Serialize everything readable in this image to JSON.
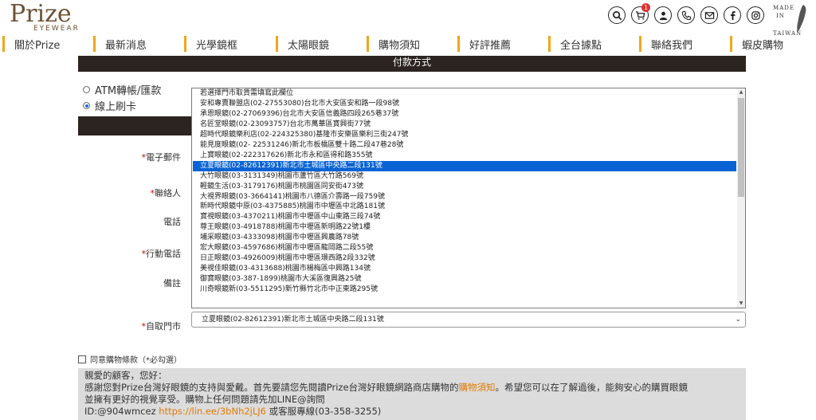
{
  "brand": {
    "name": "Prize",
    "sub": "EYEWEAR"
  },
  "made_in": {
    "line1": "MADE",
    "line2": "IN",
    "line3": "TAIWAN"
  },
  "cart": {
    "count": "1"
  },
  "nav": [
    "關於Prize",
    "最新消息",
    "光學鏡框",
    "太陽眼鏡",
    "購物須知",
    "好評推薦",
    "全台據點",
    "聯絡我們",
    "蝦皮購物"
  ],
  "payment": {
    "section_title": "付款方式",
    "options": [
      "ATM轉帳/匯款",
      "線上刷卡"
    ],
    "selected": 1
  },
  "fields": {
    "email": "電子郵件",
    "contact": "聯絡人",
    "phone": "電話",
    "mobile": "行動電話",
    "note": "備註",
    "pickup": "自取門市",
    "required_mark": "*"
  },
  "store_list": [
    "若選擇門市取貨需填寫此欄位",
    "安和專賣聯盟店(02-27553080)台北市大安區安和路一段98號",
    "承恩眼鏡(02-27069396)台北市大安區信義路四段265巷37號",
    "名匠堂眼鏡(02-23093757)台北市萬華區寶興街77號",
    "超時代眼鏡樂利店(02-224325380)基隆市安樂區樂利三街247號",
    "能見度眼鏡(02- 22531246)新北市板橋區雙十路二段47巷28號",
    "上寶眼鏡(02-222317626)新北市永和區得和路355號",
    "立夏眼鏡(02-82612391)新北市土城區中央路二段131號",
    "大竹眼鏡(03-3131349)桃園市蘆竹區大竹路569號",
    "輕鏡生活(03-3179176)桃園市桃園區同安街473號",
    "大視界眼鏡(03-3664141)桃園市八德區介壽路一段759號",
    "新時代眼鏡中原(03-4375885)桃園市中壢區中北路181號",
    "寶視眼鏡(03-4370211)桃園市中壢區中山東路三段74號",
    "尊王眼鏡(03-4918788)桃園市中壢區新明路22號1樓",
    "埔采眼鏡(03-4333098)桃園市中壢區興農路78號",
    "宏大眼鏡(03-4597686)桃園市中壢區龍岡路二段55號",
    "日正眼鏡(03-4926009)桃園市中壢區環西路2段332號",
    "美視佳眼鏡(03-4313688)桃園市楊梅區中興路134號",
    "御寶眼鏡(03-387-1899)桃園市大溪區復興路25號",
    "川奇眼鏡新(03-5511295)新竹縣竹北市中正東路295號"
  ],
  "store_selected_index": 7,
  "store_selected_value": "立夏眼鏡(02-82612391)新北市土城區中央路二段131號",
  "agree": {
    "label": "同意購物條款（*必勾選）"
  },
  "notice": {
    "line1": "親愛的顧客，您好：",
    "line2_a": "感謝您對Prize台灣好眼鏡的支持與愛戴。首先要請您先閱讀Prize台灣好眼鏡網路商店購物的",
    "line2_link": "購物須知",
    "line2_b": "。希望您可以在了解過後，能夠安心的購買眼鏡",
    "line3": "並擁有更好的視覺享受。購物上任何問題請先加LINE@詢問",
    "line4_a": "ID:@904wmcez ",
    "line4_link": "https://lin.ee/3bNh2jLJ6",
    "line4_b": " 或客服專線(03-358-3255)"
  },
  "colors": {
    "accent": "#f0a61b",
    "dark_bar": "#2b2420",
    "selection": "#0a63d4",
    "link": "#e07b00"
  }
}
